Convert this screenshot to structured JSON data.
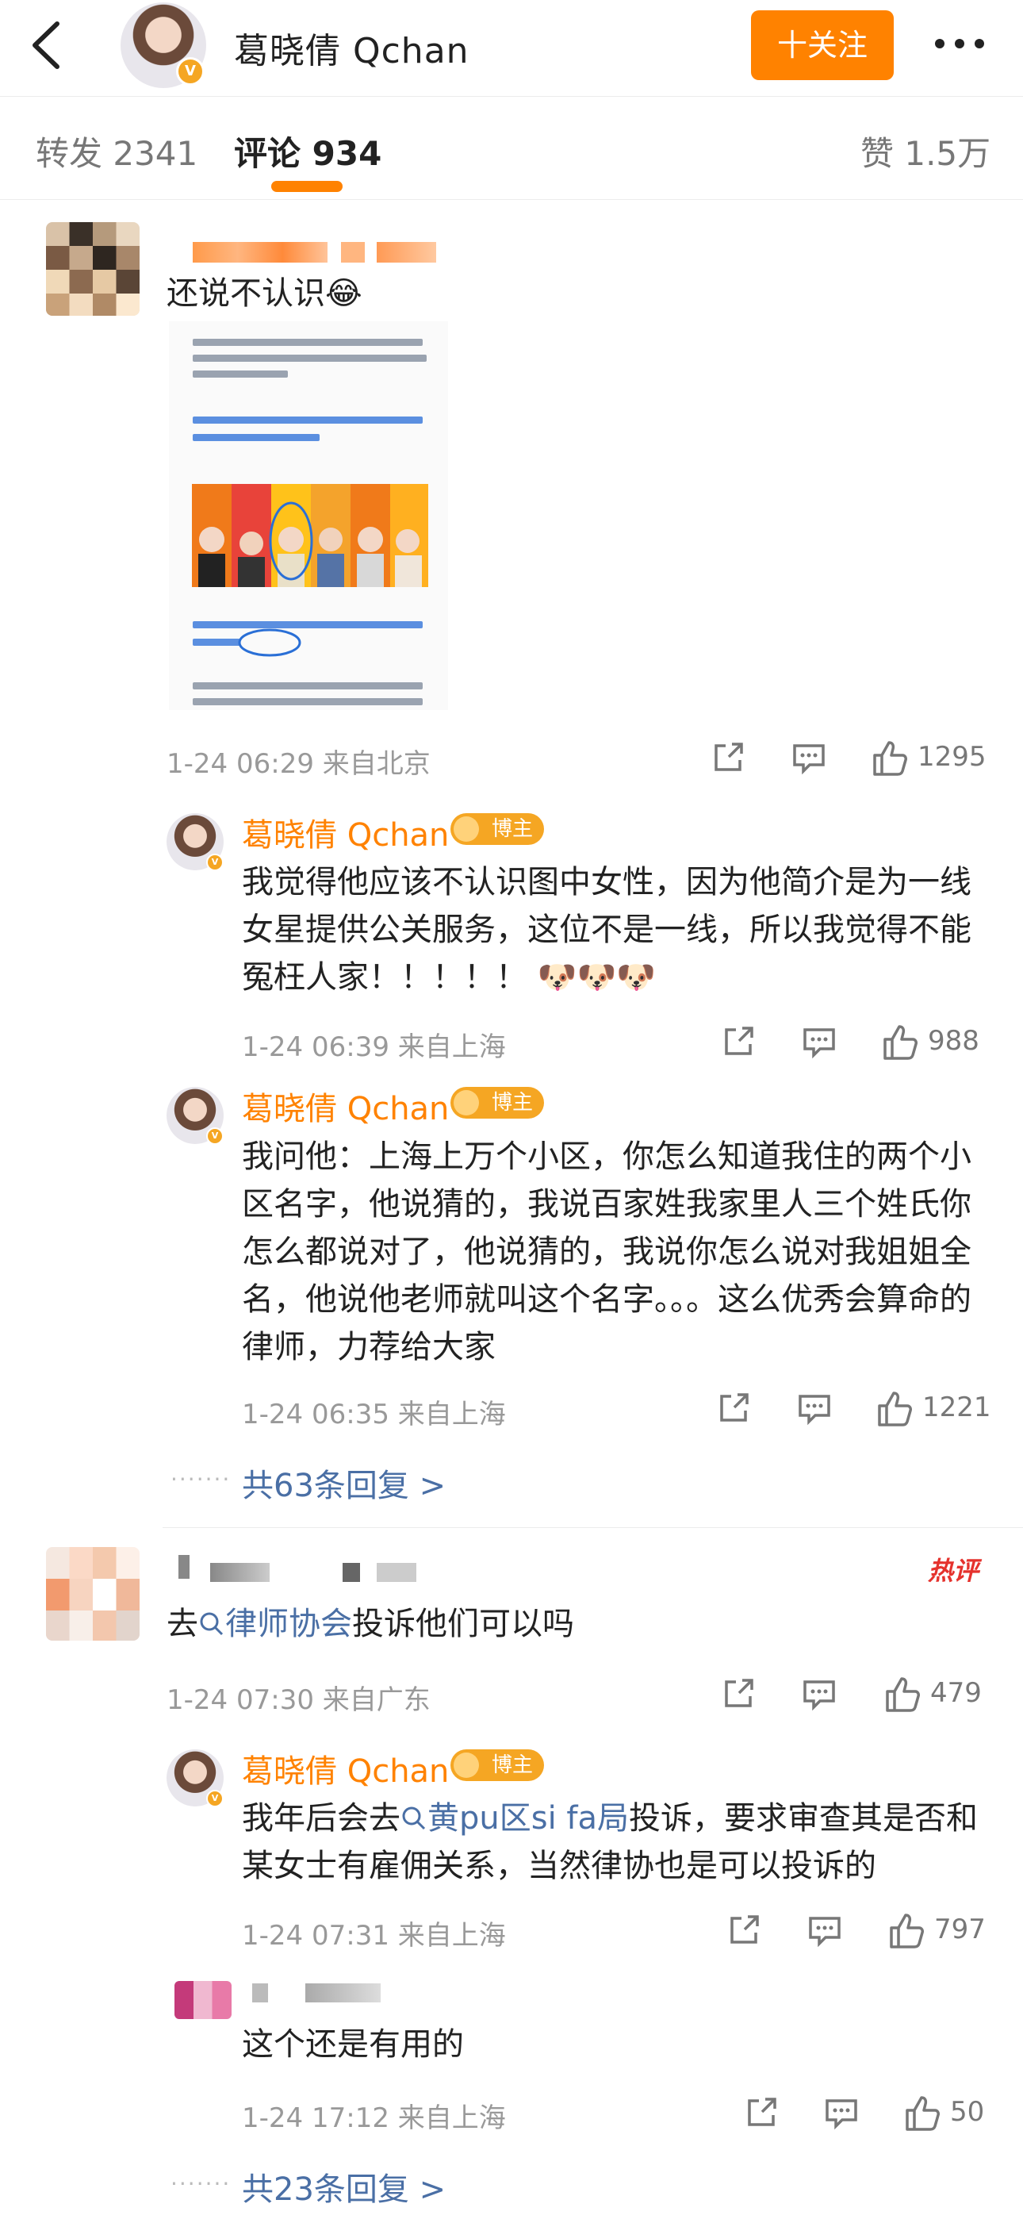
{
  "header": {
    "title": "葛晓倩 Qchan",
    "follow_label": "十关注"
  },
  "tabs": {
    "repost": "转发 2341",
    "comments": "评论 934",
    "likes": "赞 1.5万"
  },
  "blogger_badge": "博主",
  "hot_label": "热评",
  "comments": [
    {
      "text": "还说不认识😂",
      "meta": "1-24 06:29  来自北京",
      "likes": "1295",
      "replies": [
        {
          "name": "葛晓倩 Qchan",
          "text": "我觉得他应该不认识图中女性，因为他简介是为一线女星提供公关服务，这位不是一线，所以我觉得不能冤枉人家！！！！！ 🐶🐶🐶",
          "meta": "1-24 06:39  来自上海",
          "likes": "988"
        },
        {
          "name": "葛晓倩 Qchan",
          "text": "我问他：上海上万个小区，你怎么知道我住的两个小区名字，他说猜的，我说百家姓我家里人三个姓氏你怎么都说对了，他说猜的，我说你怎么说对我姐姐全名，他说他老师就叫这个名字。。。这么优秀会算命的律师，力荐给大家",
          "meta": "1-24 06:35  来自上海",
          "likes": "1221"
        }
      ],
      "more_replies": "共63条回复 >"
    },
    {
      "text_prefix": "去",
      "link": "律师协会",
      "text_suffix": "投诉他们可以吗",
      "meta": "1-24 07:30  来自广东",
      "likes": "479",
      "replies": [
        {
          "name": "葛晓倩 Qchan",
          "text_prefix": "我年后会去",
          "link": "黄pu区si fa局",
          "text_suffix": "投诉，要求审查其是否和某女士有雇佣关系，当然律协也是可以投诉的",
          "meta": "1-24 07:31  来自上海",
          "likes": "797"
        },
        {
          "text": "这个还是有用的",
          "meta": "1-24 17:12  来自上海",
          "likes": "50"
        }
      ],
      "more_replies": "共23条回复 >"
    }
  ],
  "dots": "·······"
}
